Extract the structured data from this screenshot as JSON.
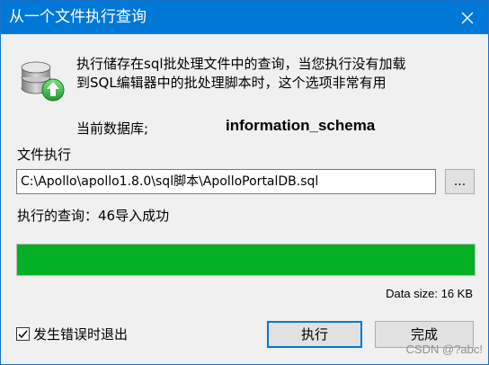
{
  "window": {
    "title": "从一个文件执行查询"
  },
  "description": {
    "line1": "执行储存在sql批处理文件中的查询，当您执行没有加载",
    "line2": "到SQL编辑器中的批处理脚本时，这个选项非常有用"
  },
  "current_db": {
    "label": "当前数据库;",
    "value": "information_schema"
  },
  "file_exec": {
    "label": "文件执行",
    "path": "C:\\Apollo\\apollo1.8.0\\sql脚本\\ApolloPortalDB.sql",
    "browse_label": "..."
  },
  "status": {
    "text": "执行的查询：46导入成功"
  },
  "progress": {
    "fraction": 1.0,
    "data_size": "Data size: 16 KB"
  },
  "exit_on_error": {
    "label": "发生错误时退出",
    "checked": true
  },
  "buttons": {
    "execute": "执行",
    "done": "完成"
  },
  "watermark": "CSDN @?abc!",
  "colors": {
    "titlebar": "#0078d7",
    "progress": "#06b025"
  },
  "icons": {
    "app": "database-upload-icon",
    "close": "close-icon",
    "check": "checkmark-icon"
  }
}
